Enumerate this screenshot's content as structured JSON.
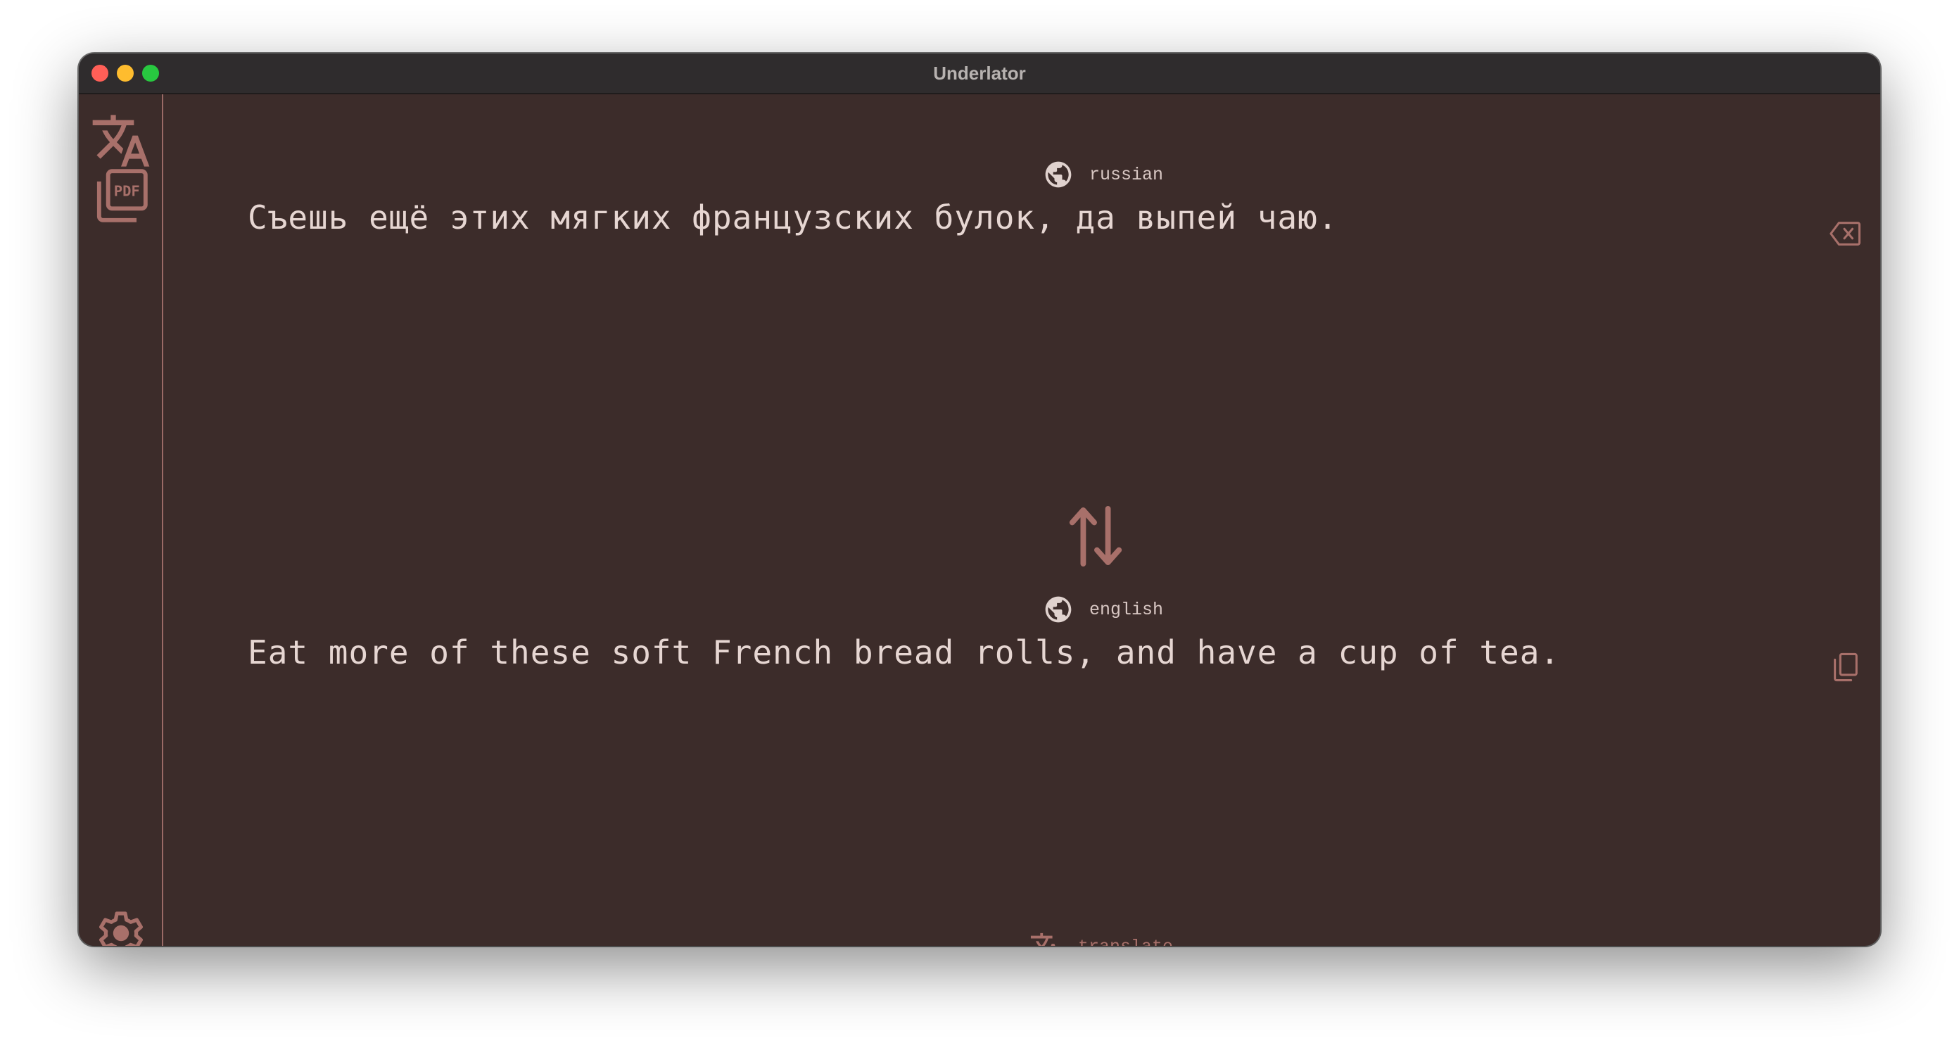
{
  "window": {
    "title": "Underlator"
  },
  "sidebar": {
    "items": [
      {
        "icon": "translate-icon"
      },
      {
        "icon": "pdf-icon"
      },
      {
        "icon": "gear-icon"
      }
    ]
  },
  "source": {
    "language": "russian",
    "text": "Съешь ещё этих мягких французских булок, да выпей чаю."
  },
  "target": {
    "language": "english",
    "text": "Eat more of these soft French bread rolls, and have a cup of tea."
  },
  "footer": {
    "translate_label": "translate"
  },
  "colors": {
    "background": "#3c2c2a",
    "accent": "#a8706a",
    "text": "#e6d6d2",
    "titlebar": "#2f2c2d"
  }
}
